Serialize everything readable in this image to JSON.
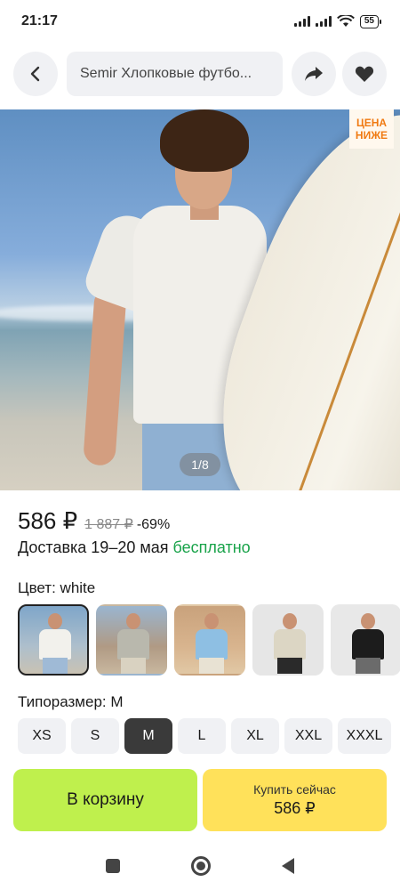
{
  "status": {
    "time": "21:17",
    "battery": "55"
  },
  "header": {
    "search_text": "Semir Хлопковые футбо..."
  },
  "icons": {
    "back": "arrow-left-icon",
    "share": "share-icon",
    "favorite": "heart-icon"
  },
  "gallery": {
    "counter": "1/8",
    "badge_line1": "ЦЕНА",
    "badge_line2": "НИЖЕ"
  },
  "price": {
    "current": "586 ₽",
    "old": "1 887 ₽",
    "discount": "-69%"
  },
  "delivery": {
    "text": "Доставка 19–20 мая",
    "free": "бесплатно"
  },
  "color": {
    "label": "Цвет: white",
    "options": [
      "white",
      "grey",
      "blue",
      "beige",
      "black"
    ]
  },
  "size": {
    "label": "Типоразмер: M",
    "options": [
      "XS",
      "S",
      "M",
      "L",
      "XL",
      "XXL",
      "XXXL"
    ],
    "selected": "M"
  },
  "actions": {
    "cart_label": "В корзину",
    "buy_label": "Купить сейчас",
    "buy_price": "586 ₽"
  },
  "colors": {
    "cart": "#bff04d",
    "buy": "#ffe15a",
    "free": "#19a34a",
    "badge": "#f07a12"
  }
}
